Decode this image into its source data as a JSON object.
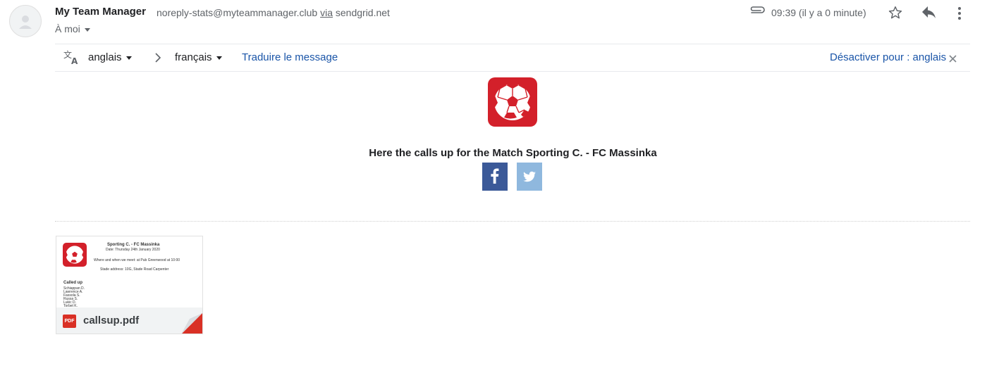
{
  "header": {
    "sender_name": "My Team Manager",
    "sender_email": "noreply-stats@myteammanager.club",
    "via_label": "via",
    "via_domain": "sendgrid.net",
    "to_label": "À moi",
    "time": "09:39 (il y a 0 minute)"
  },
  "translate_bar": {
    "source_lang": "anglais",
    "target_lang": "français",
    "translate_link": "Traduire le message",
    "disable_link": "Désactiver pour : anglais"
  },
  "email_body": {
    "headline": "Here the calls up for the Match Sporting C. - FC Massinka"
  },
  "attachment": {
    "filename": "callsup.pdf",
    "badge": "PDF",
    "preview": {
      "title": "Sporting C. - FC Massinka",
      "date_line": "Date: Thursday 24th January 2020",
      "meet_line": "Where and when we meet: at Pub Greenwood at 10:00",
      "stadium_line": "Stade address: 10G, Stade Road Carpenter",
      "called_up_label": "Called up",
      "players": [
        "Schiappan D.",
        "Lawrence A.",
        "Fassola S.",
        "Russa S.",
        "Lukic D.",
        "Torbet K."
      ]
    }
  },
  "colors": {
    "brand_red": "#d3202a",
    "link_blue": "#1a55a8",
    "facebook": "#3b5998",
    "twitter": "#8fb8de"
  }
}
